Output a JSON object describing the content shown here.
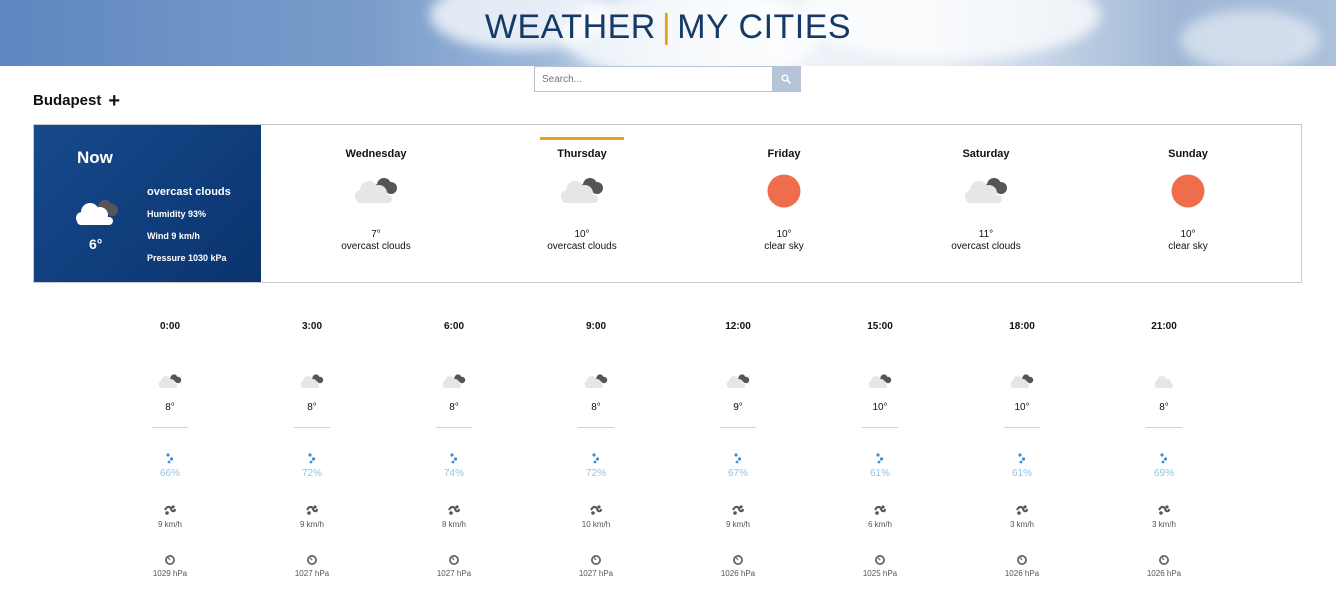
{
  "header": {
    "title_left": "WEATHER",
    "separator": "|",
    "title_right": "MY CITIES",
    "accent_color": "#e3a11b",
    "title_color": "#163a66"
  },
  "search": {
    "placeholder": "Search...",
    "icon": "search-icon"
  },
  "city": {
    "name": "Budapest",
    "add_icon": "plus-icon"
  },
  "now": {
    "label": "Now",
    "temp": "6°",
    "description": "overcast clouds",
    "humidity": "Humidity 93%",
    "wind": "Wind 9 km/h",
    "pressure": "Pressure 1030 kPa",
    "icon": "overcast-clouds-icon"
  },
  "days": [
    {
      "name": "Wednesday",
      "temp": "7°",
      "desc": "overcast clouds",
      "icon": "overcast-clouds-icon",
      "selected": false
    },
    {
      "name": "Thursday",
      "temp": "10°",
      "desc": "overcast clouds",
      "icon": "overcast-clouds-icon",
      "selected": true
    },
    {
      "name": "Friday",
      "temp": "10°",
      "desc": "clear sky",
      "icon": "sun-icon",
      "selected": false
    },
    {
      "name": "Saturday",
      "temp": "11°",
      "desc": "overcast clouds",
      "icon": "overcast-clouds-icon",
      "selected": false
    },
    {
      "name": "Sunday",
      "temp": "10°",
      "desc": "clear sky",
      "icon": "sun-icon",
      "selected": false
    }
  ],
  "hours": [
    {
      "time": "0:00",
      "temp": "8°",
      "humidity": "66%",
      "wind": "9 km/h",
      "pressure": "1029 hPa",
      "icon": "broken-clouds-icon"
    },
    {
      "time": "3:00",
      "temp": "8°",
      "humidity": "72%",
      "wind": "9 km/h",
      "pressure": "1027 hPa",
      "icon": "broken-clouds-icon"
    },
    {
      "time": "6:00",
      "temp": "8°",
      "humidity": "74%",
      "wind": "8 km/h",
      "pressure": "1027 hPa",
      "icon": "broken-clouds-icon"
    },
    {
      "time": "9:00",
      "temp": "8°",
      "humidity": "72%",
      "wind": "10 km/h",
      "pressure": "1027 hPa",
      "icon": "broken-clouds-icon"
    },
    {
      "time": "12:00",
      "temp": "9°",
      "humidity": "67%",
      "wind": "9 km/h",
      "pressure": "1026 hPa",
      "icon": "broken-clouds-icon"
    },
    {
      "time": "15:00",
      "temp": "10°",
      "humidity": "61%",
      "wind": "6 km/h",
      "pressure": "1025 hPa",
      "icon": "broken-clouds-icon"
    },
    {
      "time": "18:00",
      "temp": "10°",
      "humidity": "61%",
      "wind": "3 km/h",
      "pressure": "1026 hPa",
      "icon": "broken-clouds-icon"
    },
    {
      "time": "21:00",
      "temp": "8°",
      "humidity": "69%",
      "wind": "3 km/h",
      "pressure": "1026 hPa",
      "icon": "few-clouds-icon"
    }
  ],
  "colors": {
    "now_panel": "#0f3c7a",
    "sun": "#ef6d4a",
    "humidity_text": "#8dc5e8",
    "raindrop": "#3c8fd1"
  }
}
